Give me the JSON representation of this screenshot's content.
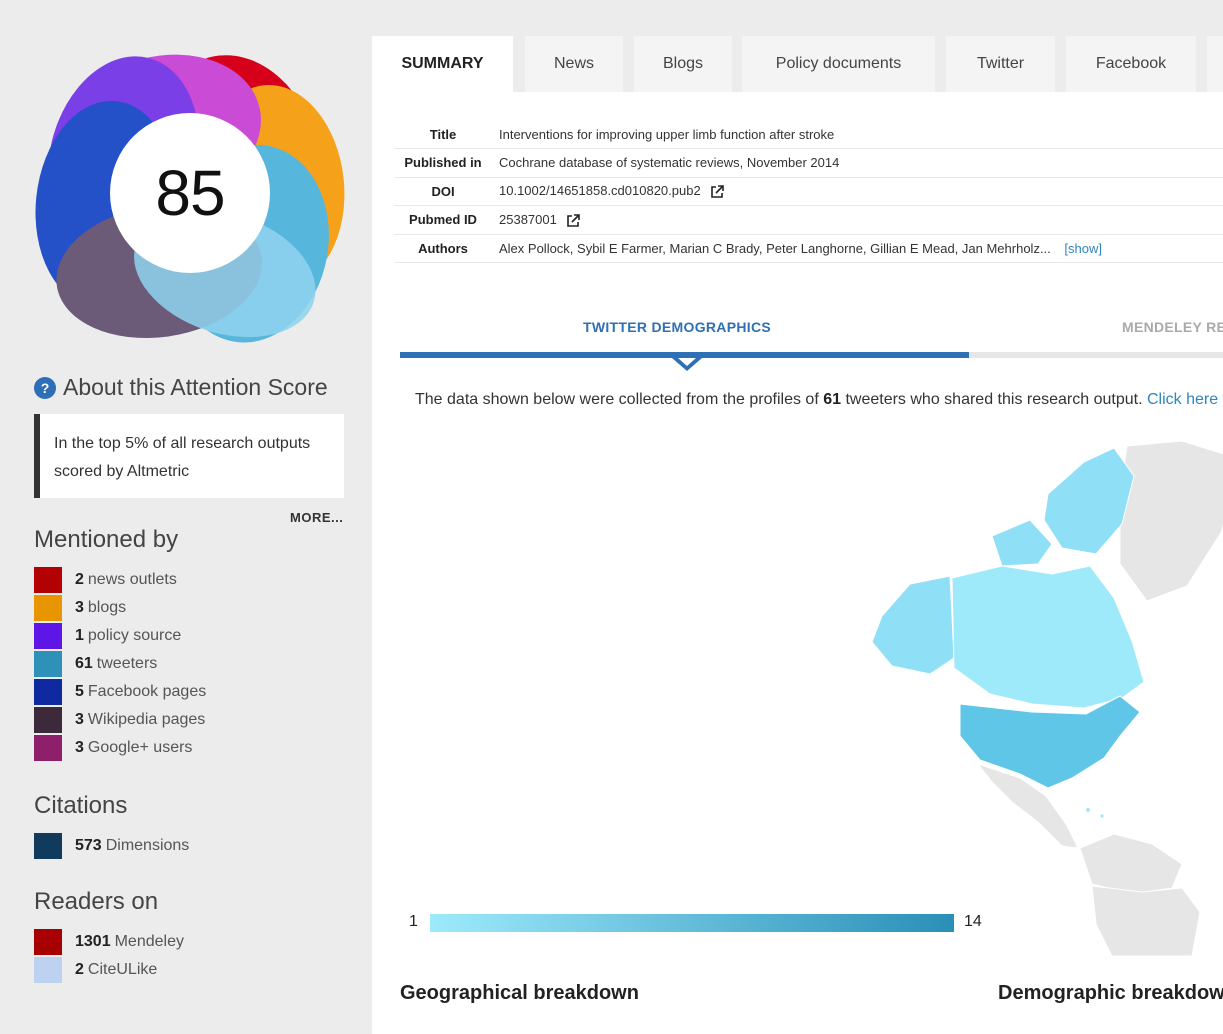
{
  "score": {
    "value": "85",
    "about_label": "About this Attention Score",
    "rank_text": "In the top 5% of all research outputs scored by Altmetric",
    "more_label": "MORE..."
  },
  "mentioned_by": {
    "heading": "Mentioned by",
    "items": [
      {
        "count": "2",
        "label": "news outlets",
        "color": "#b30000"
      },
      {
        "count": "3",
        "label": "blogs",
        "color": "#e89500"
      },
      {
        "count": "1",
        "label": "policy source",
        "color": "#5d16e6"
      },
      {
        "count": "61",
        "label": "tweeters",
        "color": "#2f90b9"
      },
      {
        "count": "5",
        "label": "Facebook pages",
        "color": "#0f2aa1"
      },
      {
        "count": "3",
        "label": "Wikipedia pages",
        "color": "#3c2a3a"
      },
      {
        "count": "3",
        "label": "Google+ users",
        "color": "#8e1f6a"
      }
    ]
  },
  "citations": {
    "heading": "Citations",
    "items": [
      {
        "count": "573",
        "label": "Dimensions",
        "color": "#103b5c"
      }
    ]
  },
  "readers": {
    "heading": "Readers on",
    "items": [
      {
        "count": "1301",
        "label": "Mendeley",
        "color": "#a60000"
      },
      {
        "count": "2",
        "label": "CiteULike",
        "color": "#bdd2f0"
      }
    ]
  },
  "tabs": [
    "SUMMARY",
    "News",
    "Blogs",
    "Policy documents",
    "Twitter",
    "Facebook"
  ],
  "details": {
    "title_label": "Title",
    "title_value": "Interventions for improving upper limb function after stroke",
    "published_label": "Published in",
    "published_value": "Cochrane database of systematic reviews, November 2014",
    "doi_label": "DOI",
    "doi_value": "10.1002/14651858.cd010820.pub2",
    "pubmed_label": "Pubmed ID",
    "pubmed_value": "25387001",
    "authors_label": "Authors",
    "authors_value": "Alex Pollock, Sybil E Farmer, Marian C Brady, Peter Langhorne, Gillian E Mead, Jan Mehrholz...",
    "show_label": "[show]"
  },
  "demographics": {
    "tab_twitter": "TWITTER DEMOGRAPHICS",
    "tab_mendeley": "MENDELEY READERS",
    "text_before": "The data shown below were collected from the profiles of ",
    "tweeter_count": "61",
    "text_after": " tweeters who shared this research output. ",
    "text_link": "Click here to find out more about how the information was compiled.",
    "scale_min": "1",
    "scale_max": "14",
    "geo_heading": "Geographical breakdown",
    "demo_heading": "Demographic breakdown"
  },
  "colors": {
    "accent": "#2e6fb5",
    "map_low": "#9eeafb",
    "map_high": "#2a8fb8",
    "map_none": "#e6e6e6"
  }
}
